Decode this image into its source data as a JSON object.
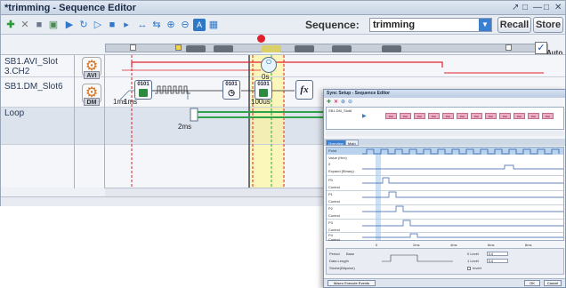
{
  "window": {
    "title": "*trimming - Sequence Editor",
    "controls": [
      "↗",
      "□",
      "—",
      "□",
      "✕"
    ]
  },
  "toolbar": {
    "sequence_label": "Sequence:",
    "sequence_value": "trimming",
    "recall_label": "Recall",
    "store_label": "Store",
    "auto_label": "Auto"
  },
  "rows": [
    {
      "label_line1": "SB1.AVI_Slot",
      "label_line2": "3.CH2",
      "device": "AVI"
    },
    {
      "label_line1": "SB1.DM_Slot6",
      "label_line2": "",
      "device": "DM"
    },
    {
      "label_line1": "Loop",
      "label_line2": "",
      "device": ""
    }
  ],
  "timeline": {
    "labels": {
      "t0s": "0s",
      "t1ms": "1ms",
      "t1ms_b": "1ms",
      "t100us": "100us",
      "t2ms": "2ms",
      "fx": "fx",
      "blk_code": "0101"
    }
  },
  "sync": {
    "title": "Sync Setup - Sequence Editor",
    "top_label": "SB1.DM_Slot6",
    "tabs": [
      "Overview",
      "Main"
    ],
    "pink_label": "Dac",
    "wave_labels": [
      "Point",
      "Value (Hex)",
      "0",
      "Expand (Binary)",
      "P0",
      "Control",
      "P1",
      "Control",
      "P2",
      "Control",
      "P3",
      "Control",
      "P4",
      "Control"
    ],
    "axis_labels": [
      "0",
      "2ms",
      "4ms",
      "6ms",
      "8ms"
    ],
    "params": {
      "period_label": "Period",
      "base_label": "Base",
      "data_length_label": "Data Length",
      "strobe_label": "Strobe(Bitpulse)",
      "level0_label": "0 Level",
      "level0_value": "0.4",
      "level1_label": "1 Level",
      "level1_value": "0.4",
      "invert_label": "Invert"
    },
    "exec_label": "Macro Execute Events",
    "ok_label": "OK",
    "cancel_label": "Cancel"
  },
  "colors": {
    "accent": "#3c7fd0",
    "red_signal": "#e2222b",
    "green_signal": "#2ea34a",
    "highlight": "#fff696"
  }
}
